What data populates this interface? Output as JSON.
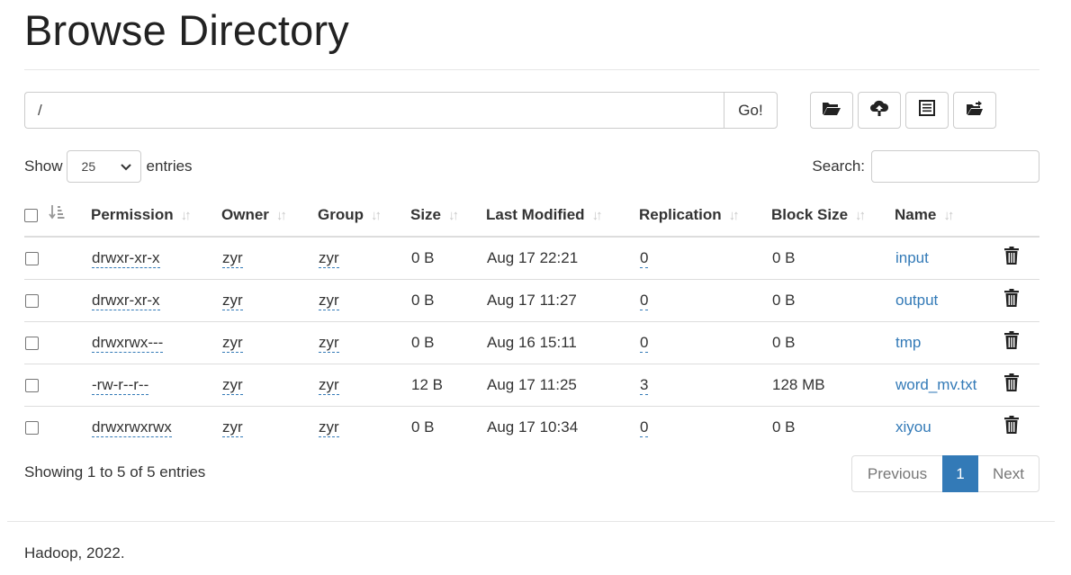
{
  "page": {
    "title": "Browse Directory"
  },
  "path_bar": {
    "value": "/",
    "go_label": "Go!"
  },
  "toolbar": {
    "icons": [
      "folder-open-icon",
      "cloud-upload-icon",
      "list-alt-icon",
      "folder-move-icon"
    ]
  },
  "entries_control": {
    "show_label": "Show",
    "selected": "25",
    "entries_label": "entries"
  },
  "search": {
    "label": "Search:",
    "value": ""
  },
  "table": {
    "columns": [
      "Permission",
      "Owner",
      "Group",
      "Size",
      "Last Modified",
      "Replication",
      "Block Size",
      "Name"
    ],
    "rows": [
      {
        "permission": "drwxr-xr-x",
        "owner": "zyr",
        "group": "zyr",
        "size": "0 B",
        "last_modified": "Aug 17 22:21",
        "replication": "0",
        "block_size": "0 B",
        "name": "input"
      },
      {
        "permission": "drwxr-xr-x",
        "owner": "zyr",
        "group": "zyr",
        "size": "0 B",
        "last_modified": "Aug 17 11:27",
        "replication": "0",
        "block_size": "0 B",
        "name": "output"
      },
      {
        "permission": "drwxrwx---",
        "owner": "zyr",
        "group": "zyr",
        "size": "0 B",
        "last_modified": "Aug 16 15:11",
        "replication": "0",
        "block_size": "0 B",
        "name": "tmp"
      },
      {
        "permission": "-rw-r--r--",
        "owner": "zyr",
        "group": "zyr",
        "size": "12 B",
        "last_modified": "Aug 17 11:25",
        "replication": "3",
        "block_size": "128 MB",
        "name": "word_mv.txt"
      },
      {
        "permission": "drwxrwxrwx",
        "owner": "zyr",
        "group": "zyr",
        "size": "0 B",
        "last_modified": "Aug 17 10:34",
        "replication": "0",
        "block_size": "0 B",
        "name": "xiyou"
      }
    ]
  },
  "info": "Showing 1 to 5 of 5 entries",
  "pagination": {
    "previous": "Previous",
    "current": "1",
    "next": "Next"
  },
  "footer": "Hadoop, 2022.",
  "colors": {
    "link": "#337ab7",
    "active_page": "#337ab7"
  }
}
